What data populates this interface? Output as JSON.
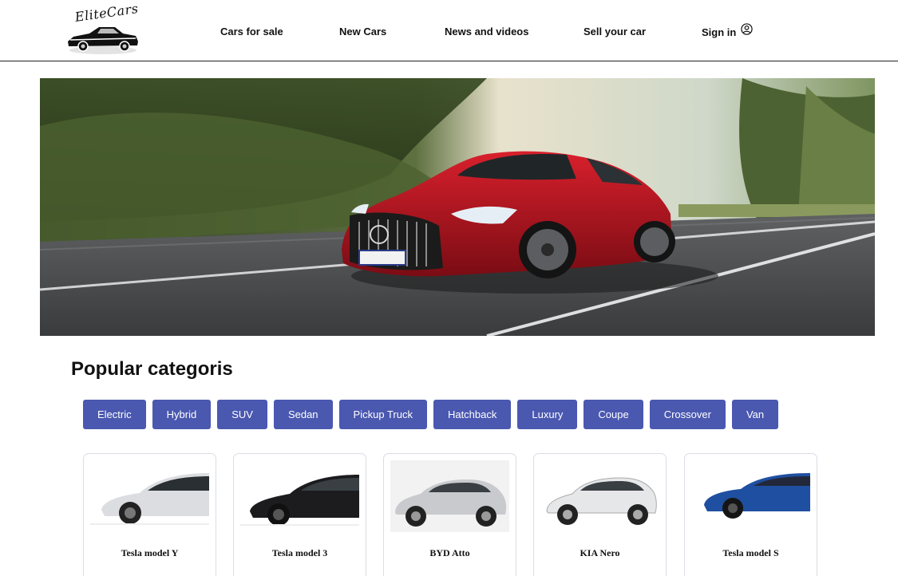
{
  "brand": {
    "name": "EliteCars"
  },
  "nav": {
    "items": [
      {
        "label": "Cars for sale"
      },
      {
        "label": "New Cars"
      },
      {
        "label": "News and videos"
      },
      {
        "label": "Sell your car"
      }
    ],
    "signin_label": "Sign in",
    "signin_icon": "user-circle-icon"
  },
  "hero": {
    "image": "red-sports-car-on-road"
  },
  "categories": {
    "title": "Popular categoris",
    "chips": [
      "Electric",
      "Hybrid",
      "SUV",
      "Sedan",
      "Pickup Truck",
      "Hatchback",
      "Luxury",
      "Coupe",
      "Crossover",
      "Van"
    ],
    "chip_color": "#4a58b0"
  },
  "cars": [
    {
      "name": "Tesla model Y",
      "color": "#d9dadc"
    },
    {
      "name": "Tesla model 3",
      "color": "#1c1c1e"
    },
    {
      "name": "BYD Atto",
      "color": "#c9cacd"
    },
    {
      "name": "KIA Nero",
      "color": "#e4e5e7"
    },
    {
      "name": "Tesla model S",
      "color": "#1f4fa0"
    }
  ]
}
